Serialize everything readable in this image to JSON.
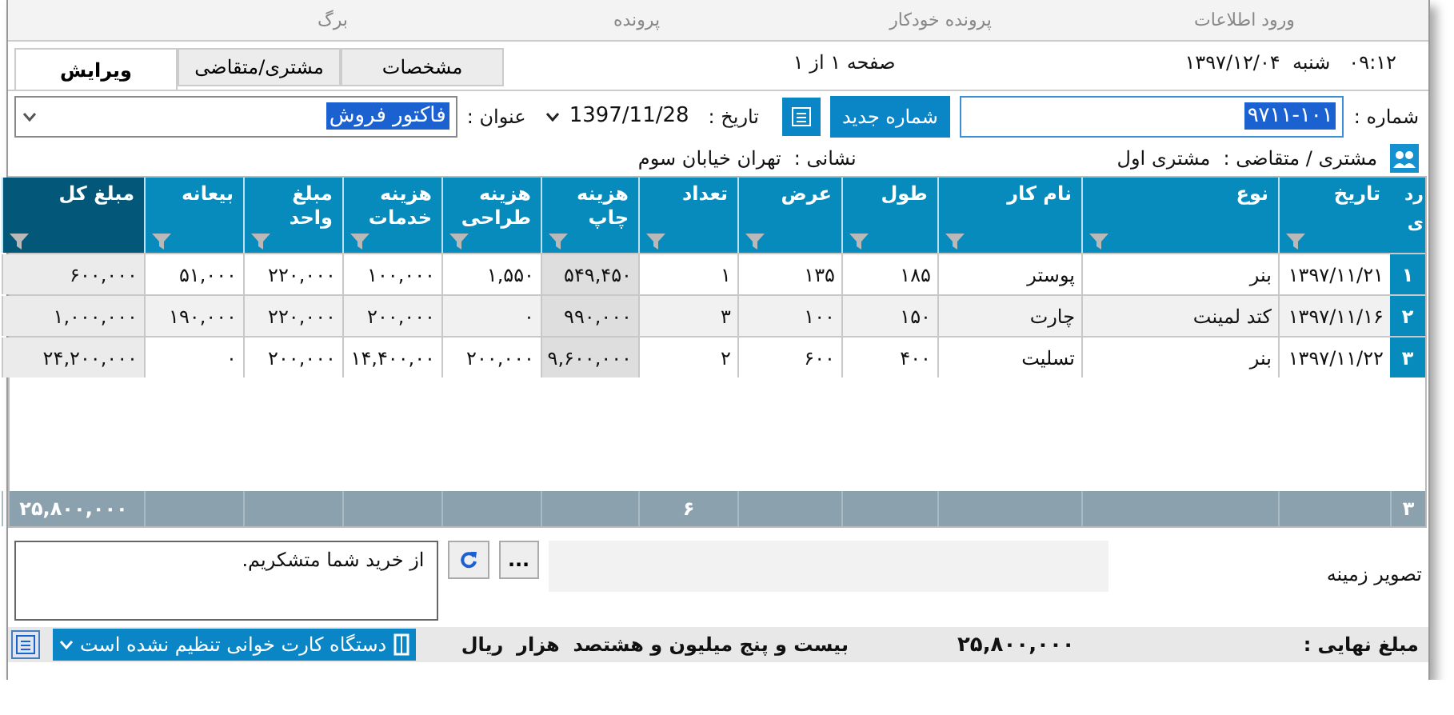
{
  "menu_tabs": [
    {
      "label": "ورود اطلاعات"
    },
    {
      "label": "پرونده خودکار"
    },
    {
      "label": "پرونده"
    },
    {
      "label": "برگ"
    }
  ],
  "datetime": {
    "time": "۰۹:۱۲",
    "weekday": "شنبه",
    "date": "۱۳۹۷/۱۲/۰۴"
  },
  "page_indicator": "صفحه ۱ از ۱",
  "tabs": [
    {
      "label": "مشخصات",
      "selected": false
    },
    {
      "label": "مشتری/متقاضی",
      "selected": false
    },
    {
      "label": "ویرایش",
      "selected": true
    }
  ],
  "form": {
    "number_label": "شماره :",
    "number_value": "۹۷۱۱-۱۰۱",
    "new_number_button": "شماره جدید",
    "date_label": "تاریخ :",
    "date_value": "1397/11/28",
    "title_label": "عنوان :",
    "title_value": "فاکتور فروش"
  },
  "customer": {
    "label": "مشتری / متقاضی :",
    "value": "مشتری اول",
    "address_label": "نشانی :",
    "address_value": "تهران خیابان سوم"
  },
  "table": {
    "row_number_header": "ردی",
    "row_count_total": "۳",
    "columns": [
      {
        "label": "تاریخ",
        "selected": false,
        "shaded": false
      },
      {
        "label": "نوع",
        "selected": false,
        "shaded": false
      },
      {
        "label": "نام کار",
        "selected": false,
        "shaded": false
      },
      {
        "label": "طول",
        "selected": false,
        "shaded": false
      },
      {
        "label": "عرض",
        "selected": false,
        "shaded": false
      },
      {
        "label": "تعداد",
        "selected": false,
        "shaded": false,
        "total": "۶"
      },
      {
        "label": "هزینه چاپ",
        "selected": false,
        "shaded": true
      },
      {
        "label": "هزینه طراحی",
        "selected": false,
        "shaded": false
      },
      {
        "label": "هزینه خدمات",
        "selected": false,
        "shaded": false
      },
      {
        "label": "مبلغ واحد",
        "selected": false,
        "shaded": false
      },
      {
        "label": "بیعانه",
        "selected": false,
        "shaded": false
      },
      {
        "label": "مبلغ کل",
        "selected": true,
        "shaded": false,
        "total": "۲۵,۸۰۰,۰۰۰"
      }
    ],
    "rows": [
      {
        "number": "۱",
        "cells": [
          "۱۳۹۷/۱۱/۲۱",
          "بنر",
          "پوستر",
          "۱۸۵",
          "۱۳۵",
          "۱",
          "۵۴۹,۴۵۰",
          "۱,۵۵۰",
          "۱۰۰,۰۰۰",
          "۲۲۰,۰۰۰",
          "۵۱,۰۰۰",
          "۶۰۰,۰۰۰"
        ]
      },
      {
        "number": "۲",
        "cells": [
          "۱۳۹۷/۱۱/۱۶",
          "کتد لمینت",
          "چارت",
          "۱۵۰",
          "۱۰۰",
          "۳",
          "۹۹۰,۰۰۰",
          "۰",
          "۲۰۰,۰۰۰",
          "۲۲۰,۰۰۰",
          "۱۹۰,۰۰۰",
          "۱,۰۰۰,۰۰۰"
        ]
      },
      {
        "number": "۳",
        "cells": [
          "۱۳۹۷/۱۱/۲۲",
          "بنر",
          "تسلیت",
          "۴۰۰",
          "۶۰۰",
          "۲",
          "۹,۶۰۰,۰۰۰",
          "۲۰۰,۰۰۰",
          "۱۴,۴۰۰,۰۰",
          "۲۰۰,۰۰۰",
          "۰",
          "۲۴,۲۰۰,۰۰۰"
        ]
      }
    ]
  },
  "note": "از خرید شما متشکریم.",
  "more_button": "...",
  "background_image_label": "تصویر زمینه",
  "footer": {
    "final_label": "مبلغ نهایی :",
    "final_amount": "۲۵,۸۰۰,۰۰۰",
    "amount_words": "بیست و پنج میلیون و هشتصد  هزار  ریال",
    "card_reader": "دستگاه کارت خوانی تنظیم نشده است"
  }
}
